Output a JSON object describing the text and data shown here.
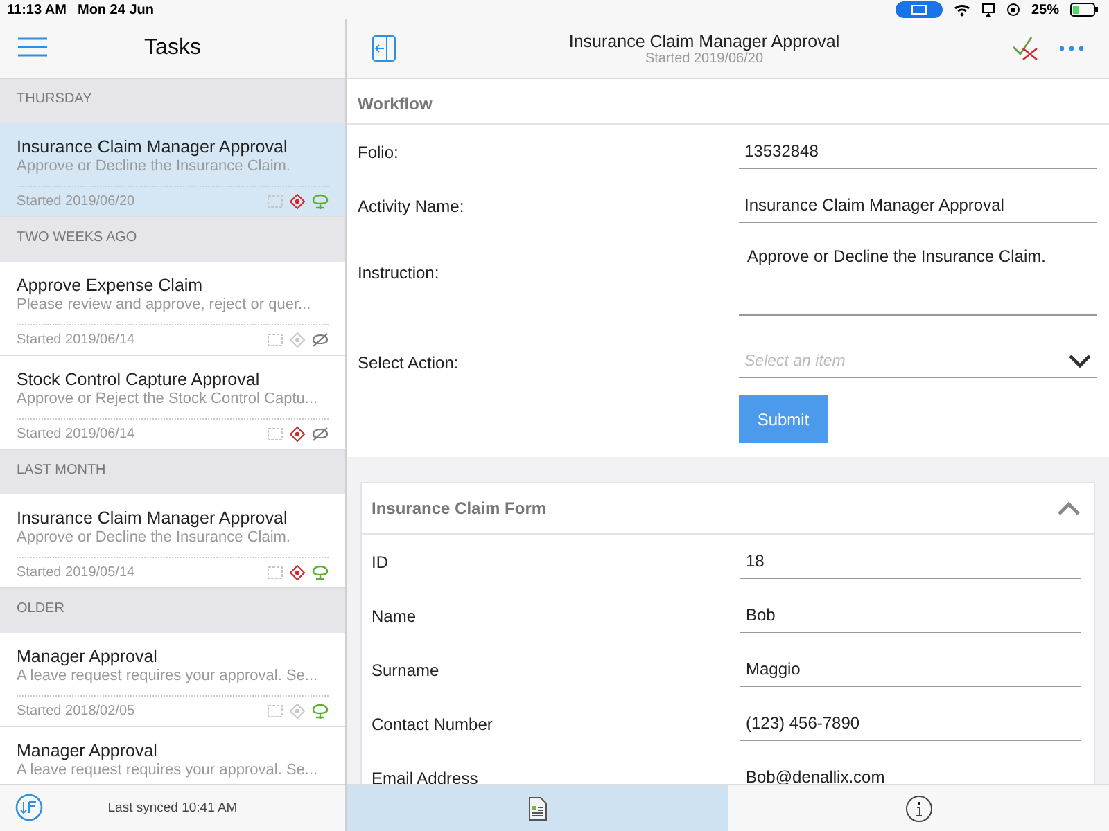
{
  "status_bar": {
    "time": "11:13 AM",
    "date": "Mon 24 Jun",
    "battery": "25%"
  },
  "tasks_pane": {
    "title": "Tasks",
    "groups": [
      {
        "heading": "THURSDAY",
        "tasks": [
          {
            "title": "Insurance Claim Manager Approval",
            "subtitle": "Approve or Decline the Insurance Claim.",
            "started": "Started 2019/06/20",
            "flagged": true,
            "synced": true,
            "selected": true
          }
        ]
      },
      {
        "heading": "TWO WEEKS AGO",
        "tasks": [
          {
            "title": "Approve Expense Claim",
            "subtitle": "Please review and approve, reject or quer...",
            "started": "Started 2019/06/14",
            "flagged": false,
            "synced": false,
            "selected": false
          },
          {
            "title": "Stock Control Capture Approval",
            "subtitle": "Approve or Reject the Stock Control Captu...",
            "started": "Started 2019/06/14",
            "flagged": true,
            "synced": false,
            "selected": false
          }
        ]
      },
      {
        "heading": "LAST MONTH",
        "tasks": [
          {
            "title": "Insurance Claim Manager Approval",
            "subtitle": "Approve or Decline the Insurance Claim.",
            "started": "Started 2019/05/14",
            "flagged": true,
            "synced": true,
            "selected": false
          }
        ]
      },
      {
        "heading": "OLDER",
        "tasks": [
          {
            "title": "Manager Approval",
            "subtitle": "A leave request requires your approval. Se...",
            "started": "Started 2018/02/05",
            "flagged": false,
            "synced": true,
            "selected": false
          },
          {
            "title": "Manager Approval",
            "subtitle": "A leave request requires your approval. Se...",
            "selected": false
          }
        ]
      }
    ],
    "footer": "Last synced 10:41 AM"
  },
  "detail": {
    "title": "Insurance Claim Manager Approval",
    "subtitle": "Started 2019/06/20",
    "workflow": {
      "heading": "Workflow",
      "fields": [
        {
          "label": "Folio:",
          "value": "13532848",
          "kind": "text"
        },
        {
          "label": "Activity Name:",
          "value": "Insurance Claim Manager Approval",
          "kind": "text"
        },
        {
          "label": "Instruction:",
          "value": "Approve or Decline the Insurance Claim.",
          "kind": "multiline"
        },
        {
          "label": "Select Action:",
          "placeholder": "Select an item",
          "kind": "dropdown"
        }
      ],
      "button": "Submit"
    },
    "form": {
      "heading": "Insurance Claim Form",
      "expanded": true,
      "fields": [
        {
          "label": "ID",
          "value": "18"
        },
        {
          "label": "Name",
          "value": "Bob"
        },
        {
          "label": "Surname",
          "value": "Maggio"
        },
        {
          "label": "Contact Number",
          "value": "(123) 456-7890"
        },
        {
          "label": "Email Address",
          "value": "Bob@denallix.com"
        }
      ]
    },
    "tabs": [
      {
        "kind": "document",
        "selected": true
      },
      {
        "kind": "info",
        "selected": false
      }
    ]
  }
}
